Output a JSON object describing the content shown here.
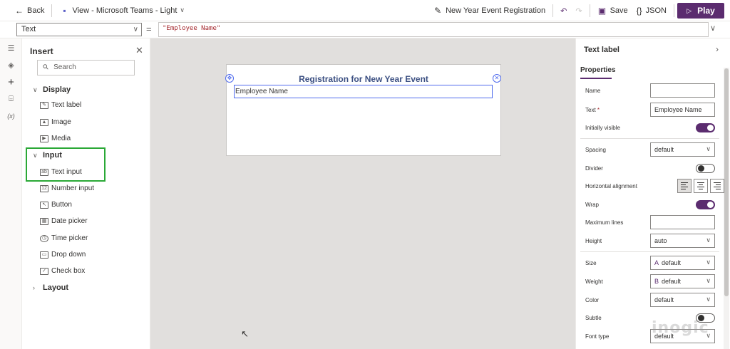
{
  "topbar": {
    "back_label": "Back",
    "view_label": "View - Microsoft Teams - Light",
    "app_name": "New Year Event Registration",
    "save_label": "Save",
    "json_label": "JSON",
    "play_label": "Play"
  },
  "formulabar": {
    "property": "Text",
    "equals": "=",
    "formula": "\"Employee Name\""
  },
  "insert": {
    "title": "Insert",
    "search_placeholder": "Search",
    "categories": [
      {
        "label": "Display",
        "items": [
          "Text label",
          "Image",
          "Media"
        ]
      },
      {
        "label": "Input",
        "items": [
          "Text input",
          "Number input",
          "Button",
          "Date picker",
          "Time picker",
          "Drop down",
          "Check box"
        ]
      },
      {
        "label": "Layout",
        "items": []
      }
    ]
  },
  "canvas": {
    "title": "Registration for New Year Event",
    "field_text": "Employee Name"
  },
  "props": {
    "title": "Text label",
    "tab": "Properties",
    "name_label": "Name",
    "name_value": "",
    "text_label": "Text",
    "text_required": "*",
    "text_value": "Employee Name",
    "visible_label": "Initially visible",
    "visible": true,
    "spacing_label": "Spacing",
    "spacing_value": "default",
    "divider_label": "Divider",
    "divider": false,
    "halign_label": "Horizontal alignment",
    "halign_value": "left",
    "wrap_label": "Wrap",
    "wrap": true,
    "maxlines_label": "Maximum lines",
    "maxlines_value": "",
    "height_label": "Height",
    "height_value": "auto",
    "size_label": "Size",
    "size_prefix": "A",
    "size_value": "default",
    "weight_label": "Weight",
    "weight_prefix": "B",
    "weight_value": "default",
    "color_label": "Color",
    "color_value": "default",
    "subtle_label": "Subtle",
    "subtle": false,
    "fonttype_label": "Font type",
    "fonttype_value": "default"
  },
  "watermark": "inogic",
  "colors": {
    "accent": "#5b2c6f",
    "highlight": "#2aa836",
    "title_text": "#3b4f82",
    "selection": "#4f6bed"
  }
}
